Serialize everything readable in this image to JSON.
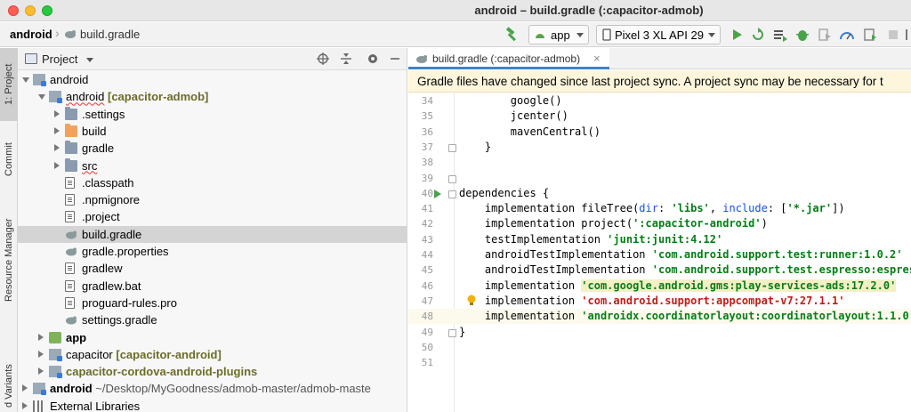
{
  "window": {
    "title": "android – build.gradle (:capacitor-admob)"
  },
  "navbar": {
    "breadcrumb_root": "android",
    "breadcrumb_file": "build.gradle",
    "run_config": "app",
    "device": "Pixel 3 XL API 29"
  },
  "side_tabs": {
    "project": "1: Project",
    "commit": "Commit",
    "resource_manager": "Resource Manager",
    "build_variants": "d Variants"
  },
  "project_panel": {
    "title": "Project",
    "tree": [
      {
        "label": "android",
        "indent": 0,
        "expanded": true,
        "icon": "module-icon",
        "style": "normal"
      },
      {
        "label": "android",
        "module": "[capacitor-admob]",
        "indent": 1,
        "expanded": true,
        "icon": "module-icon",
        "style": "squiggle"
      },
      {
        "label": ".settings",
        "indent": 2,
        "expanded": false,
        "icon": "folder-icon"
      },
      {
        "label": "build",
        "indent": 2,
        "expanded": false,
        "icon": "folder-orange-icon"
      },
      {
        "label": "gradle",
        "indent": 2,
        "expanded": false,
        "icon": "folder-icon"
      },
      {
        "label": "src",
        "indent": 2,
        "expanded": false,
        "icon": "folder-icon",
        "style": "squiggle"
      },
      {
        "label": ".classpath",
        "indent": 2,
        "icon": "file-icon"
      },
      {
        "label": ".npmignore",
        "indent": 2,
        "icon": "file-icon"
      },
      {
        "label": ".project",
        "indent": 2,
        "icon": "file-icon"
      },
      {
        "label": "build.gradle",
        "indent": 2,
        "icon": "gradle-icon",
        "selected": true
      },
      {
        "label": "gradle.properties",
        "indent": 2,
        "icon": "gradle-icon"
      },
      {
        "label": "gradlew",
        "indent": 2,
        "icon": "file-icon"
      },
      {
        "label": "gradlew.bat",
        "indent": 2,
        "icon": "file-icon"
      },
      {
        "label": "proguard-rules.pro",
        "indent": 2,
        "icon": "file-icon"
      },
      {
        "label": "settings.gradle",
        "indent": 2,
        "icon": "gradle-icon"
      },
      {
        "label": "app",
        "indent": 1,
        "expanded": false,
        "icon": "app-module-icon",
        "style": "bold"
      },
      {
        "label": "capacitor",
        "module": "[capacitor-android]",
        "indent": 1,
        "expanded": false,
        "icon": "module-icon"
      },
      {
        "label": "capacitor-cordova-android-plugins",
        "indent": 1,
        "expanded": false,
        "icon": "module-icon",
        "style": "module-bold"
      },
      {
        "label": "android",
        "path": "~/Desktop/MyGoodness/admob-master/admob-maste",
        "indent": 0,
        "expanded": false,
        "icon": "module-icon",
        "style": "bold"
      },
      {
        "label": "External Libraries",
        "indent": 0,
        "expanded": false,
        "icon": "library-icon"
      }
    ]
  },
  "editor": {
    "tab_label": "build.gradle (:capacitor-admob)",
    "tab_close": "×",
    "banner": "Gradle files have changed since last project sync. A project sync may be necessary for t",
    "lines": [
      {
        "n": "34",
        "parts": [
          {
            "t": "        google()"
          }
        ]
      },
      {
        "n": "35",
        "parts": [
          {
            "t": "        jcenter()"
          }
        ]
      },
      {
        "n": "36",
        "parts": [
          {
            "t": "        mavenCentral()"
          }
        ]
      },
      {
        "n": "37",
        "parts": [
          {
            "t": "    }"
          }
        ],
        "fold": true
      },
      {
        "n": "38",
        "parts": [
          {
            "t": ""
          }
        ]
      },
      {
        "n": "39",
        "parts": [
          {
            "t": ""
          }
        ],
        "fold": true
      },
      {
        "n": "40",
        "parts": [
          {
            "t": "dependencies {"
          }
        ],
        "fold": true,
        "run": true
      },
      {
        "n": "41",
        "parts": [
          {
            "t": "    implementation fileTree("
          },
          {
            "t": "dir",
            "c": "named"
          },
          {
            "t": ": "
          },
          {
            "t": "'libs'",
            "c": "str"
          },
          {
            "t": ", "
          },
          {
            "t": "include",
            "c": "named"
          },
          {
            "t": ": ["
          },
          {
            "t": "'*.jar'",
            "c": "str"
          },
          {
            "t": "])"
          }
        ]
      },
      {
        "n": "42",
        "parts": [
          {
            "t": "    implementation project("
          },
          {
            "t": "':capacitor-android'",
            "c": "str"
          },
          {
            "t": ")"
          }
        ]
      },
      {
        "n": "43",
        "parts": [
          {
            "t": "    testImplementation "
          },
          {
            "t": "'junit:junit:4.12'",
            "c": "str"
          }
        ]
      },
      {
        "n": "44",
        "parts": [
          {
            "t": "    androidTestImplementation "
          },
          {
            "t": "'com.android.support.test:runner:1.0.2'",
            "c": "str"
          }
        ]
      },
      {
        "n": "45",
        "parts": [
          {
            "t": "    androidTestImplementation "
          },
          {
            "t": "'com.android.support.test.espresso:espresso-co",
            "c": "str"
          }
        ]
      },
      {
        "n": "46",
        "parts": [
          {
            "t": "    implementation "
          },
          {
            "t": "'com.google.android.gms:play-services-ads:17.2.0'",
            "c": "str str-hl"
          }
        ]
      },
      {
        "n": "47",
        "parts": [
          {
            "t": "    implementation "
          },
          {
            "t": "'com.android.support:appcompat-v7:27.1.1'",
            "c": "str-warn"
          }
        ],
        "bulb": true
      },
      {
        "n": "48",
        "parts": [
          {
            "t": "    implementation "
          },
          {
            "t": "'androidx.coordinatorlayout:coordinatorlayout:1.1.0'",
            "c": "str"
          }
        ],
        "current": true
      },
      {
        "n": "49",
        "parts": [
          {
            "t": "}"
          }
        ],
        "fold": true
      },
      {
        "n": "50",
        "parts": [
          {
            "t": ""
          }
        ]
      },
      {
        "n": "51",
        "parts": [
          {
            "t": ""
          }
        ]
      }
    ]
  },
  "colors": {
    "accent": "#4083c9",
    "banner_bg": "#fdf6dc",
    "string": "#067d17",
    "warning_string": "#c41a16",
    "named_arg": "#1750eb"
  }
}
